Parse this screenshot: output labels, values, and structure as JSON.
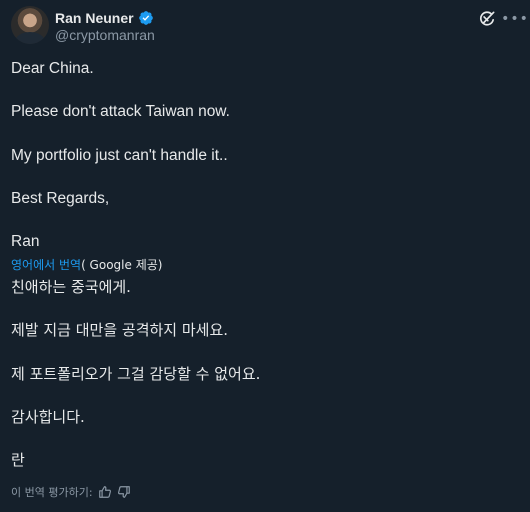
{
  "author": {
    "display_name": "Ran Neuner",
    "handle": "@cryptomanran",
    "verified": true
  },
  "post": {
    "lines": [
      "Dear China.",
      "Please don't attack Taiwan now.",
      "My portfolio just can't handle it..",
      "Best Regards,",
      "Ran"
    ]
  },
  "translation": {
    "source_link": "영어에서 번역",
    "provider": "( Google 제공)",
    "lines": [
      "친애하는 중국에게.",
      "제발 지금 대만을 공격하지 마세요.",
      "제 포트폴리오가 그걸 감당할 수 없어요.",
      "감사합니다.",
      "란"
    ],
    "rate_label": "이 번역 평가하기:"
  },
  "icons": {
    "verified": "verified-badge-icon",
    "grok": "grok-icon",
    "more": "more-options-icon",
    "thumb_up": "thumbs-up-icon",
    "thumb_down": "thumbs-down-icon"
  },
  "colors": {
    "background": "#15202b",
    "text": "#e7e9ea",
    "secondary": "#8b98a5",
    "accent": "#1d9bf0"
  }
}
